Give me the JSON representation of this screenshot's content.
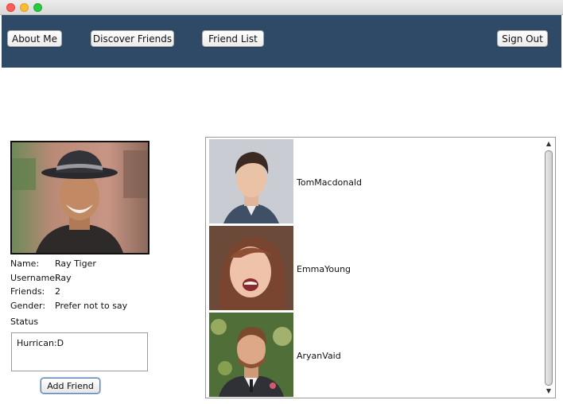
{
  "nav": {
    "about_me": "About Me",
    "discover_friends": "Discover Friends",
    "friend_list": "Friend List",
    "sign_out": "Sign Out"
  },
  "profile": {
    "name_label": "Name:",
    "name_value": "Ray Tiger",
    "username_label": "Username:",
    "username_value": "Ray",
    "friends_label": "Friends:",
    "friends_value": "2",
    "gender_label": "Gender:",
    "gender_value": "Prefer not to say",
    "status_label": "Status",
    "status_text": "Hurrican:D"
  },
  "add_friend_label": "Add Friend",
  "friends": [
    {
      "name": "TomMacdonald"
    },
    {
      "name": "EmmaYoung"
    },
    {
      "name": "AryanVaid"
    }
  ],
  "colors": {
    "navbar": "#2e4a66",
    "button_focus": "#5b7fae"
  }
}
